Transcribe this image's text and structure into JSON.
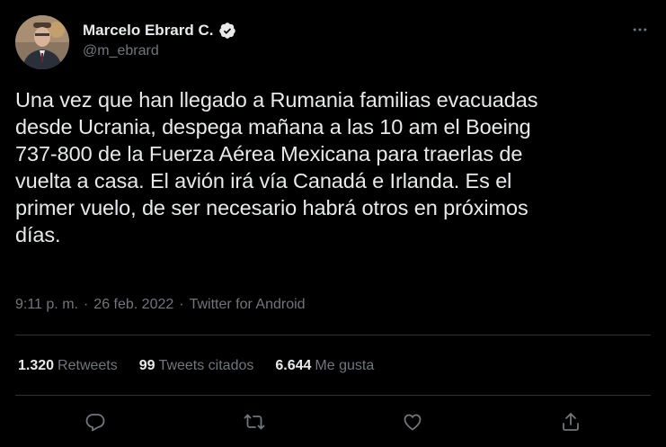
{
  "author": {
    "display_name": "Marcelo Ebrard C.",
    "handle": "@m_ebrard",
    "verified": true,
    "avatar_icon": "profile-photo"
  },
  "tweet": {
    "text": "Una vez que han llegado a Rumania familias evacuadas\ndesde Ucrania, despega mañana a las 10 am el Boeing\n737-800 de la Fuerza Aérea Mexicana para traerlas de\nvuelta a casa. El avión irá vía Canadá e Irlanda. Es el\nprimer vuelo, de ser necesario habrá otros en próximos\ndías."
  },
  "meta": {
    "time": "9:11 p. m.",
    "separator": "·",
    "date": "26 feb. 2022",
    "source": "Twitter for Android"
  },
  "stats": {
    "retweets_count": "1.320",
    "retweets_label": "Retweets",
    "quotes_count": "99",
    "quotes_label": "Tweets citados",
    "likes_count": "6.644",
    "likes_label": "Me gusta"
  },
  "actions": {
    "reply_icon": "reply-icon",
    "retweet_icon": "retweet-icon",
    "like_icon": "like-icon",
    "share_icon": "share-icon"
  },
  "colors": {
    "background": "#000000",
    "text": "#e7e9ea",
    "secondary_text": "#71767b",
    "divider": "#2f3336",
    "verified_badge": "#e7e9ea"
  }
}
